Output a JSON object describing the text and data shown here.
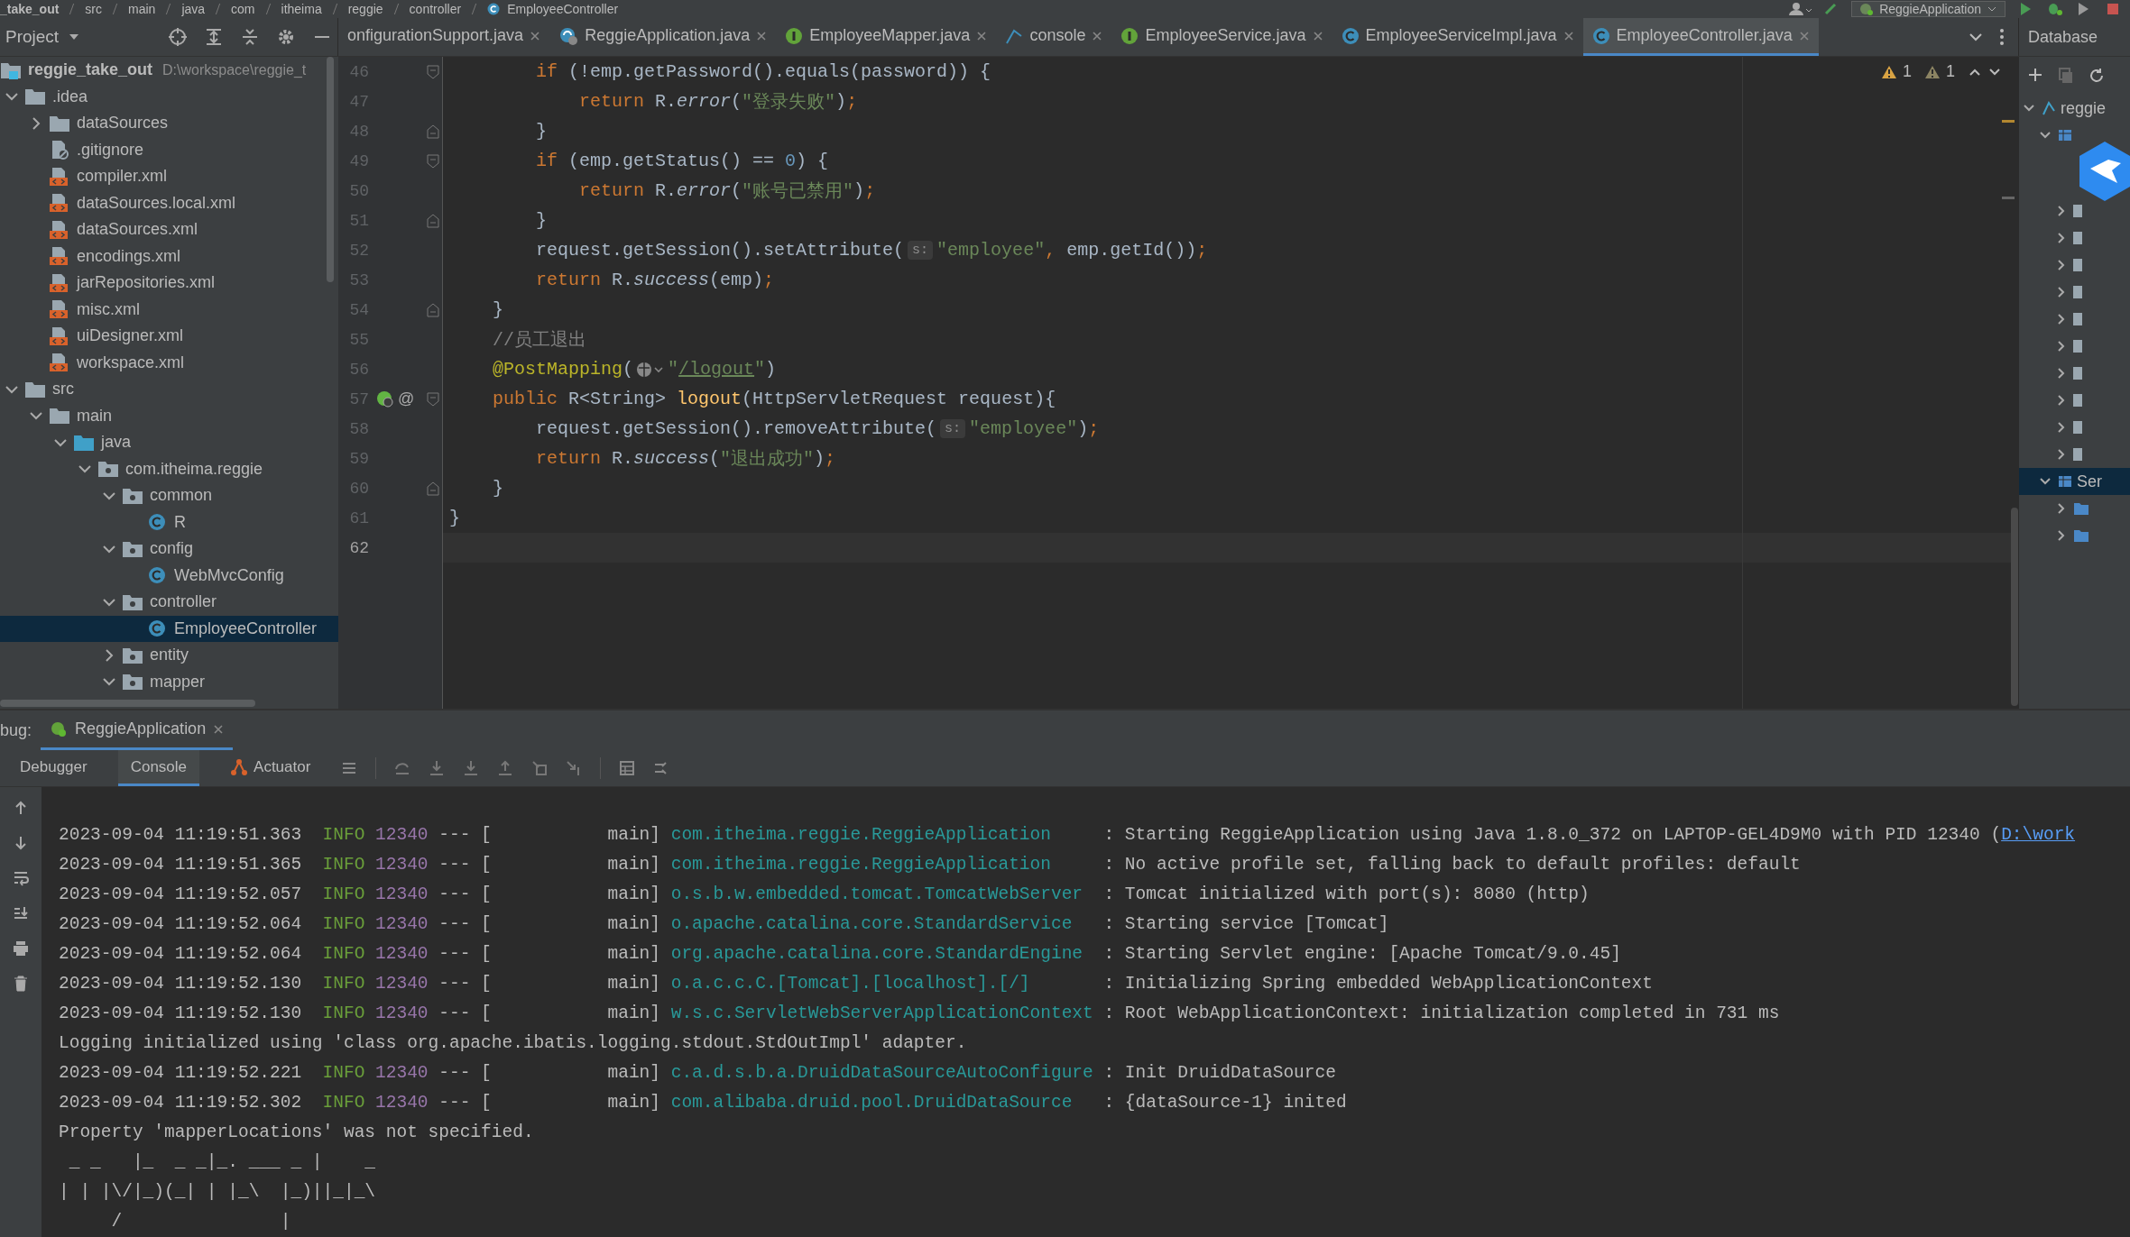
{
  "breadcrumb": [
    "_take_out",
    "src",
    "main",
    "java",
    "com",
    "itheima",
    "reggie",
    "controller",
    "EmployeeController"
  ],
  "run_config": {
    "label": "ReggieApplication"
  },
  "project_panel": {
    "title": "Project",
    "tree": [
      {
        "label": "reggie_take_out",
        "hint": "D:\\workspace\\reggie_t",
        "kind": "module",
        "selected": false,
        "children": [
          {
            "label": ".idea",
            "kind": "folder",
            "expanded": true,
            "selected": false,
            "children": [
              {
                "label": "dataSources",
                "kind": "folder",
                "expanded": false,
                "selected": false
              },
              {
                "label": ".gitignore",
                "kind": "ignore-file",
                "selected": false
              },
              {
                "label": "compiler.xml",
                "kind": "xml",
                "selected": false
              },
              {
                "label": "dataSources.local.xml",
                "kind": "xml",
                "selected": false
              },
              {
                "label": "dataSources.xml",
                "kind": "xml",
                "selected": false
              },
              {
                "label": "encodings.xml",
                "kind": "xml",
                "selected": false
              },
              {
                "label": "jarRepositories.xml",
                "kind": "xml",
                "selected": false
              },
              {
                "label": "misc.xml",
                "kind": "xml",
                "selected": false
              },
              {
                "label": "uiDesigner.xml",
                "kind": "xml",
                "selected": false
              },
              {
                "label": "workspace.xml",
                "kind": "xml",
                "selected": false
              }
            ]
          },
          {
            "label": "src",
            "kind": "folder",
            "expanded": true,
            "selected": false,
            "children": [
              {
                "label": "main",
                "kind": "folder",
                "expanded": true,
                "selected": false,
                "children": [
                  {
                    "label": "java",
                    "kind": "source-folder",
                    "expanded": true,
                    "selected": false,
                    "children": [
                      {
                        "label": "com.itheima.reggie",
                        "kind": "package",
                        "expanded": true,
                        "selected": false,
                        "children": [
                          {
                            "label": "common",
                            "kind": "package",
                            "expanded": true,
                            "selected": false,
                            "children": [
                              {
                                "label": "R",
                                "kind": "class",
                                "selected": false
                              }
                            ]
                          },
                          {
                            "label": "config",
                            "kind": "package",
                            "expanded": true,
                            "selected": false,
                            "children": [
                              {
                                "label": "WebMvcConfig",
                                "kind": "class",
                                "selected": false
                              }
                            ]
                          },
                          {
                            "label": "controller",
                            "kind": "package",
                            "expanded": true,
                            "selected": false,
                            "children": [
                              {
                                "label": "EmployeeController",
                                "kind": "class",
                                "selected": true
                              }
                            ]
                          },
                          {
                            "label": "entity",
                            "kind": "package",
                            "expanded": false,
                            "selected": false
                          },
                          {
                            "label": "mapper",
                            "kind": "package",
                            "expanded": true,
                            "selected": false
                          }
                        ]
                      }
                    ]
                  }
                ]
              }
            ]
          }
        ]
      }
    ]
  },
  "editor": {
    "tabs": [
      {
        "label": "onfigurationSupport.java",
        "selected": false
      },
      {
        "label": "ReggieApplication.java",
        "kind": "spring-run",
        "selected": false
      },
      {
        "label": "EmployeeMapper.java",
        "kind": "interface",
        "selected": false
      },
      {
        "label": "console",
        "kind": "db-console",
        "selected": false
      },
      {
        "label": "EmployeeService.java",
        "kind": "interface",
        "selected": false
      },
      {
        "label": "EmployeeServiceImpl.java",
        "kind": "class",
        "selected": false
      },
      {
        "label": "EmployeeController.java",
        "kind": "class",
        "selected": true
      }
    ],
    "warnings": [
      {
        "kind": "warning",
        "count": "1"
      },
      {
        "kind": "weak-warning",
        "count": "1"
      }
    ],
    "lines": [
      {
        "number": "46",
        "kind": "fold-start",
        "current": false,
        "tokens": [
          {
            "kind": "keyword",
            "text": "        if"
          },
          {
            "kind": "plain",
            "text": " (!emp.getPassword().equals(password)) {"
          }
        ]
      },
      {
        "number": "47",
        "kind": "plain",
        "current": false,
        "tokens": [
          {
            "kind": "keyword",
            "text": "            return"
          },
          {
            "kind": "plain",
            "text": " R."
          },
          {
            "kind": "italic",
            "text": "error"
          },
          {
            "kind": "plain",
            "text": "("
          },
          {
            "kind": "string",
            "text": "\"登录失败\""
          },
          {
            "kind": "plain",
            "text": ")"
          },
          {
            "kind": "keyword",
            "text": ";"
          }
        ]
      },
      {
        "number": "48",
        "kind": "fold-end",
        "current": false,
        "tokens": [
          {
            "kind": "plain",
            "text": "        }"
          }
        ]
      },
      {
        "number": "49",
        "kind": "fold-start",
        "current": false,
        "tokens": [
          {
            "kind": "keyword",
            "text": "        if"
          },
          {
            "kind": "plain",
            "text": " (emp.getStatus() == "
          },
          {
            "kind": "number",
            "text": "0"
          },
          {
            "kind": "plain",
            "text": ") {"
          }
        ]
      },
      {
        "number": "50",
        "kind": "plain",
        "current": false,
        "tokens": [
          {
            "kind": "keyword",
            "text": "            return"
          },
          {
            "kind": "plain",
            "text": " R."
          },
          {
            "kind": "italic",
            "text": "error"
          },
          {
            "kind": "plain",
            "text": "("
          },
          {
            "kind": "string",
            "text": "\"账号已禁用\""
          },
          {
            "kind": "plain",
            "text": ")"
          },
          {
            "kind": "keyword",
            "text": ";"
          }
        ]
      },
      {
        "number": "51",
        "kind": "fold-end",
        "current": false,
        "tokens": [
          {
            "kind": "plain",
            "text": "        }"
          }
        ]
      },
      {
        "number": "52",
        "kind": "plain",
        "current": false,
        "tokens": [
          {
            "kind": "plain",
            "text": "        request.getSession().setAttribute("
          },
          {
            "kind": "hint",
            "text": "s:"
          },
          {
            "kind": "string",
            "text": "\"employee\""
          },
          {
            "kind": "keyword",
            "text": ","
          },
          {
            "kind": "plain",
            "text": " emp.getId())"
          },
          {
            "kind": "keyword",
            "text": ";"
          }
        ]
      },
      {
        "number": "53",
        "kind": "plain",
        "current": false,
        "tokens": [
          {
            "kind": "keyword",
            "text": "        return"
          },
          {
            "kind": "plain",
            "text": " R."
          },
          {
            "kind": "italic",
            "text": "success"
          },
          {
            "kind": "plain",
            "text": "(emp)"
          },
          {
            "kind": "keyword",
            "text": ";"
          }
        ]
      },
      {
        "number": "54",
        "kind": "fold-end",
        "current": false,
        "tokens": [
          {
            "kind": "plain",
            "text": "    }"
          }
        ]
      },
      {
        "number": "55",
        "kind": "plain",
        "current": false,
        "tokens": [
          {
            "kind": "comment",
            "text": "    //员工退出"
          }
        ]
      },
      {
        "number": "56",
        "kind": "plain",
        "current": false,
        "tokens": [
          {
            "kind": "annotation",
            "text": "    @PostMapping"
          },
          {
            "kind": "plain",
            "text": "("
          },
          {
            "kind": "url-icon"
          },
          {
            "kind": "string",
            "text": "\""
          },
          {
            "kind": "link",
            "text": "/logout"
          },
          {
            "kind": "string",
            "text": "\""
          },
          {
            "kind": "plain",
            "text": ")"
          }
        ]
      },
      {
        "number": "57",
        "kind": "fold-start",
        "current": false,
        "gutter": {
          "kind": "bean",
          "text": "@"
        },
        "tokens": [
          {
            "kind": "keyword",
            "text": "    public"
          },
          {
            "kind": "plain",
            "text": " R<String> "
          },
          {
            "kind": "function",
            "text": "logout"
          },
          {
            "kind": "plain",
            "text": "(HttpServletRequest request){"
          }
        ]
      },
      {
        "number": "58",
        "kind": "plain",
        "current": false,
        "tokens": [
          {
            "kind": "plain",
            "text": "        request.getSession().removeAttribute("
          },
          {
            "kind": "hint",
            "text": "s:"
          },
          {
            "kind": "string",
            "text": "\"employee\""
          },
          {
            "kind": "plain",
            "text": ")"
          },
          {
            "kind": "keyword",
            "text": ";"
          }
        ]
      },
      {
        "number": "59",
        "kind": "plain",
        "current": false,
        "tokens": [
          {
            "kind": "keyword",
            "text": "        return"
          },
          {
            "kind": "plain",
            "text": " R."
          },
          {
            "kind": "italic",
            "text": "success"
          },
          {
            "kind": "plain",
            "text": "("
          },
          {
            "kind": "string",
            "text": "\"退出成功\""
          },
          {
            "kind": "plain",
            "text": ")"
          },
          {
            "kind": "keyword",
            "text": ";"
          }
        ]
      },
      {
        "number": "60",
        "kind": "fold-end",
        "current": false,
        "tokens": [
          {
            "kind": "plain",
            "text": "    }"
          }
        ]
      },
      {
        "number": "61",
        "kind": "plain",
        "current": false,
        "tokens": [
          {
            "kind": "plain",
            "text": "}"
          }
        ]
      },
      {
        "number": "62",
        "kind": "plain",
        "current": true
      }
    ]
  },
  "database_panel": {
    "title": "Database",
    "tree": [
      {
        "kind": "database",
        "label": "reggie",
        "expanded": true,
        "selected": false
      },
      {
        "kind": "group",
        "expanded": true,
        "selected": false
      },
      {
        "kind": "table",
        "expanded": false,
        "selected": false
      },
      {
        "kind": "table",
        "expanded": false,
        "selected": false
      },
      {
        "kind": "table",
        "expanded": false,
        "selected": false
      },
      {
        "kind": "table",
        "expanded": false,
        "selected": false
      },
      {
        "kind": "table",
        "expanded": false,
        "selected": false
      },
      {
        "kind": "table",
        "expanded": false,
        "selected": false
      },
      {
        "kind": "table",
        "expanded": false,
        "selected": false
      },
      {
        "kind": "table",
        "expanded": false,
        "selected": false
      },
      {
        "kind": "table",
        "expanded": false,
        "selected": false
      },
      {
        "kind": "table",
        "expanded": false,
        "selected": false
      },
      {
        "kind": "schema",
        "label": "Ser",
        "expanded": true,
        "selected": true
      },
      {
        "kind": "folder",
        "expanded": false,
        "selected": false
      },
      {
        "kind": "folder",
        "expanded": false,
        "selected": false
      }
    ]
  },
  "debug": {
    "label": "bug:",
    "session_tab": {
      "label": "ReggieApplication",
      "selected": true
    },
    "tabs": [
      {
        "label": "Debugger",
        "selected": false
      },
      {
        "label": "Console",
        "selected": true
      },
      {
        "label": "Actuator",
        "selected": false
      }
    ],
    "console": [
      {
        "kind": "log",
        "timestamp": "2023-09-04 11:19:51.363",
        "level": "INFO",
        "pid": "12340",
        "thread": "--- [           main]",
        "logger": "com.itheima.reggie.ReggieApplication",
        "message": ": Starting ReggieApplication using Java 1.8.0_372 on LAPTOP-GEL4D9M0 with PID 12340 (",
        "link": "D:\\work"
      },
      {
        "kind": "log",
        "timestamp": "2023-09-04 11:19:51.365",
        "level": "INFO",
        "pid": "12340",
        "thread": "--- [           main]",
        "logger": "com.itheima.reggie.ReggieApplication",
        "message": ": No active profile set, falling back to default profiles: default"
      },
      {
        "kind": "log",
        "timestamp": "2023-09-04 11:19:52.057",
        "level": "INFO",
        "pid": "12340",
        "thread": "--- [           main]",
        "logger": "o.s.b.w.embedded.tomcat.TomcatWebServer",
        "message": ": Tomcat initialized with port(s): 8080 (http)"
      },
      {
        "kind": "log",
        "timestamp": "2023-09-04 11:19:52.064",
        "level": "INFO",
        "pid": "12340",
        "thread": "--- [           main]",
        "logger": "o.apache.catalina.core.StandardService",
        "message": ": Starting service [Tomcat]"
      },
      {
        "kind": "log",
        "timestamp": "2023-09-04 11:19:52.064",
        "level": "INFO",
        "pid": "12340",
        "thread": "--- [           main]",
        "logger": "org.apache.catalina.core.StandardEngine",
        "message": ": Starting Servlet engine: [Apache Tomcat/9.0.45]"
      },
      {
        "kind": "log",
        "timestamp": "2023-09-04 11:19:52.130",
        "level": "INFO",
        "pid": "12340",
        "thread": "--- [           main]",
        "logger": "o.a.c.c.C.[Tomcat].[localhost].[/]",
        "message": ": Initializing Spring embedded WebApplicationContext"
      },
      {
        "kind": "log",
        "timestamp": "2023-09-04 11:19:52.130",
        "level": "INFO",
        "pid": "12340",
        "thread": "--- [           main]",
        "logger": "w.s.c.ServletWebServerApplicationContext",
        "message": ": Root WebApplicationContext: initialization completed in 731 ms"
      },
      {
        "kind": "text",
        "text": "Logging initialized using 'class org.apache.ibatis.logging.stdout.StdOutImpl' adapter."
      },
      {
        "kind": "log",
        "timestamp": "2023-09-04 11:19:52.221",
        "level": "INFO",
        "pid": "12340",
        "thread": "--- [           main]",
        "logger": "c.a.d.s.b.a.DruidDataSourceAutoConfigure",
        "message": ": Init DruidDataSource"
      },
      {
        "kind": "log",
        "timestamp": "2023-09-04 11:19:52.302",
        "level": "INFO",
        "pid": "12340",
        "thread": "--- [           main]",
        "logger": "com.alibaba.druid.pool.DruidDataSource",
        "message": ": {dataSource-1} inited"
      },
      {
        "kind": "text",
        "text": "Property 'mapperLocations' was not specified."
      },
      {
        "kind": "text",
        "text": " _ _   |_  _ _|_. ___ _ |    _"
      },
      {
        "kind": "text",
        "text": "| | |\\/|_)(_| | |_\\  |_)||_|_\\"
      },
      {
        "kind": "text",
        "text": "     /               |"
      }
    ]
  }
}
